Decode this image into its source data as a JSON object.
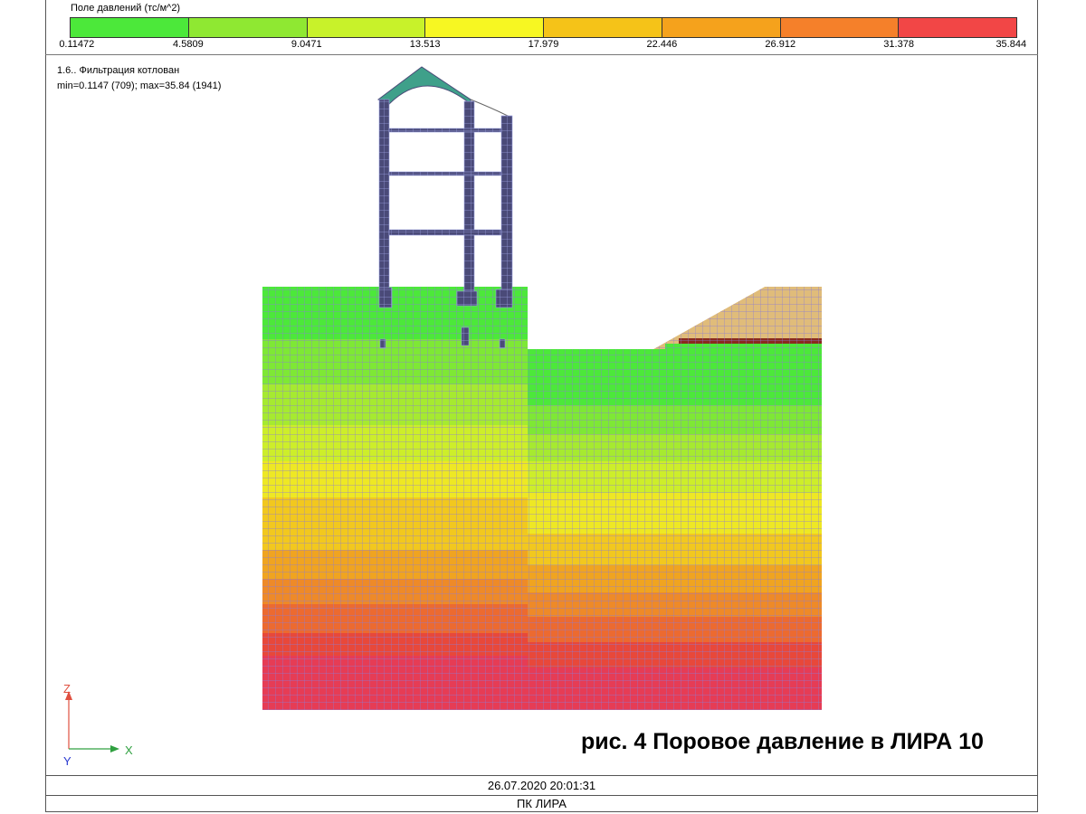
{
  "legend": {
    "title": "Поле давлений (тс/м^2)",
    "colors": [
      "#4ce83a",
      "#8fe832",
      "#c8f22a",
      "#f7f722",
      "#f5c318",
      "#f5a21c",
      "#f5802a",
      "#f24646"
    ],
    "ticks": [
      "0.11472",
      "4.5809",
      "9.0471",
      "13.513",
      "17.979",
      "22.446",
      "26.912",
      "31.378",
      "35.844"
    ]
  },
  "info": {
    "case_name": "1.6.. Фильтрация котлован",
    "range": "min=0.1147 (709); max=35.84 (1941)"
  },
  "caption": "рис. 4 Поровое давление в ЛИРА 10",
  "axes": {
    "z": "Z",
    "x": "X",
    "y": "Y"
  },
  "footer": {
    "date": "26.07.2020 20:01:31",
    "app": "ПК ЛИРА"
  },
  "model_colors": {
    "mesh_line": "#8c7cd6",
    "structure": "#4a4a78",
    "fill_soil_top": "#e0bc7a",
    "fill_soil_dark": "#8a2a1e",
    "bands": [
      "#4ce83a",
      "#7ee835",
      "#a6ea30",
      "#cdee2a",
      "#eee824",
      "#f2c81e",
      "#f0a420",
      "#ee8a28",
      "#ec6a30",
      "#e8483a",
      "#e63c55"
    ]
  }
}
